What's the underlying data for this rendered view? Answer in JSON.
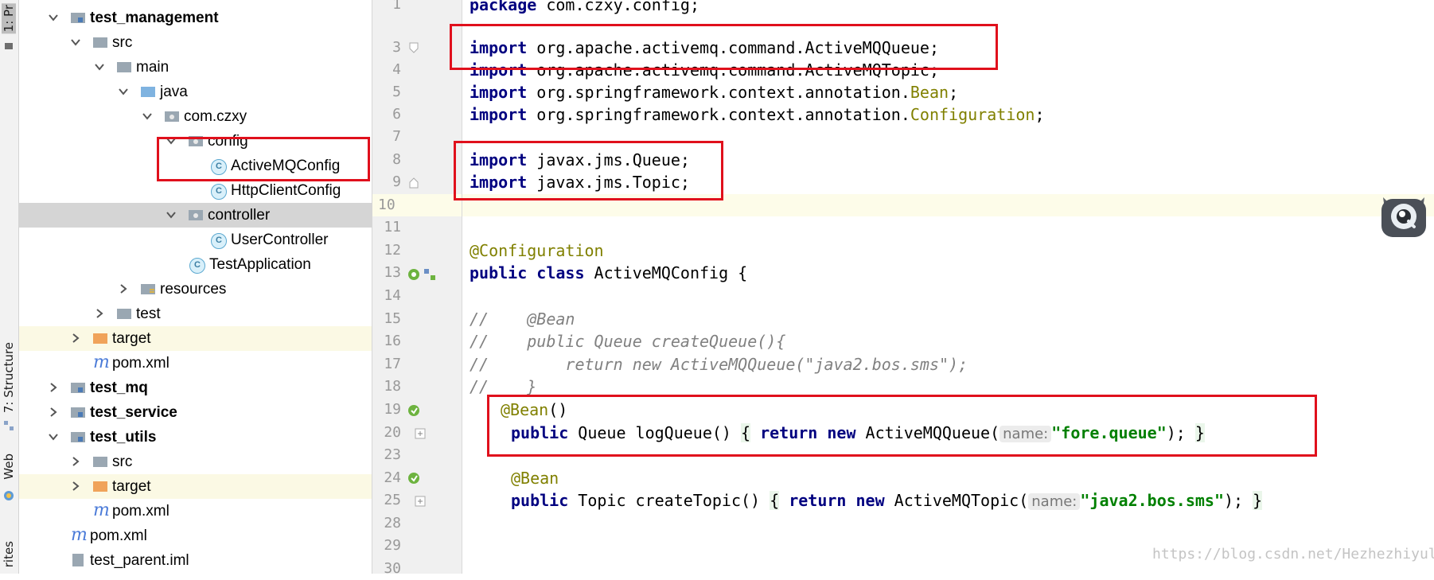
{
  "toolwindows": {
    "project_tab": "1: Pr",
    "structure_tab": "7: Structure",
    "web_tab": "Web",
    "favorites_tab": "rites"
  },
  "tree": {
    "items": [
      {
        "label": "test_management",
        "bold": true
      },
      {
        "label": "src"
      },
      {
        "label": "main"
      },
      {
        "label": "java"
      },
      {
        "label": "com.czxy"
      },
      {
        "label": "config"
      },
      {
        "label": "ActiveMQConfig"
      },
      {
        "label": "HttpClientConfig"
      },
      {
        "label": "controller"
      },
      {
        "label": "UserController"
      },
      {
        "label": "TestApplication"
      },
      {
        "label": "resources"
      },
      {
        "label": "test"
      },
      {
        "label": "target"
      },
      {
        "label": "pom.xml"
      },
      {
        "label": "test_mq",
        "bold": true
      },
      {
        "label": "test_service",
        "bold": true
      },
      {
        "label": "test_utils",
        "bold": true
      },
      {
        "label": "src"
      },
      {
        "label": "target"
      },
      {
        "label": "pom.xml"
      },
      {
        "label": "pom.xml"
      },
      {
        "label": "test_parent.iml"
      }
    ],
    "class_icon_letter": "C",
    "maven_icon_letter": "m"
  },
  "gutter": {
    "line_numbers": [
      "1",
      "3",
      "4",
      "5",
      "6",
      "7",
      "8",
      "9",
      "10",
      "11",
      "12",
      "13",
      "14",
      "15",
      "16",
      "17",
      "18",
      "19",
      "20",
      "23",
      "24",
      "25",
      "28",
      "29",
      "30"
    ]
  },
  "code": {
    "line1": {
      "kw": "package",
      "rest": " com.czxy.config;"
    },
    "line3": {
      "kw": "import",
      "rest": " org.apache.activemq.command.ActiveMQQueue;"
    },
    "line4": {
      "kw": "import",
      "rest": " org.apache.activemq.command.ActiveMQTopic;"
    },
    "line5": {
      "kw": "import",
      "rest": " org.springframework.context.annotation.",
      "ann": "Bean",
      "end": ";"
    },
    "line6": {
      "kw": "import",
      "rest": " org.springframework.context.annotation.",
      "ann": "Configuration",
      "end": ";"
    },
    "line8": {
      "kw": "import",
      "rest": " javax.jms.Queue;"
    },
    "line9": {
      "kw": "import",
      "rest": " javax.jms.Topic;"
    },
    "line12": {
      "ann": "@Configuration"
    },
    "line13": {
      "kw": "public class",
      "rest": " ActiveMQConfig {"
    },
    "line15": {
      "cmt": "//    @Bean"
    },
    "line16": {
      "cmt": "//    public Queue createQueue(){"
    },
    "line17": {
      "cmt": "//        return new ActiveMQQueue(\"java2.bos.sms\");"
    },
    "line18": {
      "cmt": "//    }"
    },
    "line19": {
      "ann": "@Bean",
      "rest": "()"
    },
    "line20": {
      "kw1": "public",
      "mid1": " Queue logQueue() ",
      "ob": "{",
      "kw2": " return new",
      "mid2": " ActiveMQQueue(",
      "hint": "name:",
      "str": "\"fore.queue\"",
      "end": ");",
      "cb": "}"
    },
    "line24": {
      "ann": "@Bean"
    },
    "line25": {
      "kw1": "public",
      "mid1": " Topic createTopic() ",
      "ob": "{",
      "kw2": " return new",
      "mid2": " ActiveMQTopic(",
      "hint": "name:",
      "str": "\"java2.bos.sms\"",
      "end": ");",
      "cb": "}"
    }
  },
  "watermark": "https://blog.csdn.net/Hezhezhiyule",
  "colors": {
    "highlight_box": "#e0101c",
    "keyword": "#000080",
    "annotation": "#808000",
    "string": "#008000",
    "comment": "#808080"
  }
}
